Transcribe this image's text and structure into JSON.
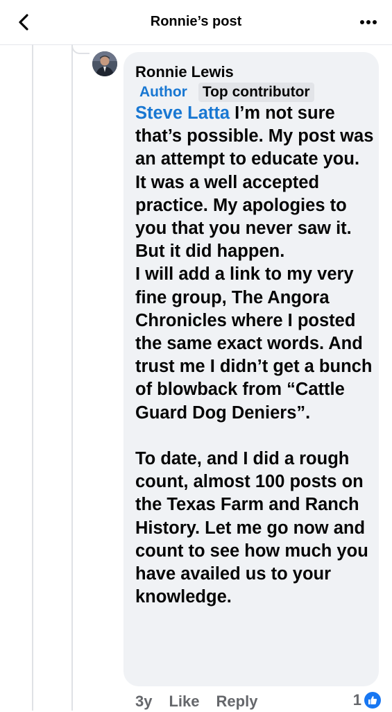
{
  "header": {
    "title": "Ronnie’s post"
  },
  "comment": {
    "author": "Ronnie Lewis",
    "badges": {
      "author": "Author",
      "top": "Top contributor"
    },
    "mention": "Steve Latta",
    "text": " I’m not sure that’s possible. My post was an attempt to educate you. It was a well accepted practice. My apologies to you that you never saw it. But it did happen.\nI will add a link to my very fine group, The Angora Chronicles where I posted the same exact words. And trust me I didn’t get a bunch of blowback from “Cattle Guard Dog Deniers”.\n\nTo date, and I did a rough count, almost 100 posts on the Texas Farm and Ranch History. Let me go now and count to see how much you have availed us to your knowledge.",
    "timestamp": "3y",
    "like_label": "Like",
    "reply_label": "Reply",
    "reaction_count": "1"
  },
  "icons": {
    "back": "chevron-left-icon",
    "more": "more-dots-icon",
    "reaction": "thumbs-up-icon"
  },
  "colors": {
    "link": "#1877d2",
    "bubble": "#f0f2f5",
    "secondary_text": "#65676b",
    "like_blue": "#1877f2"
  }
}
